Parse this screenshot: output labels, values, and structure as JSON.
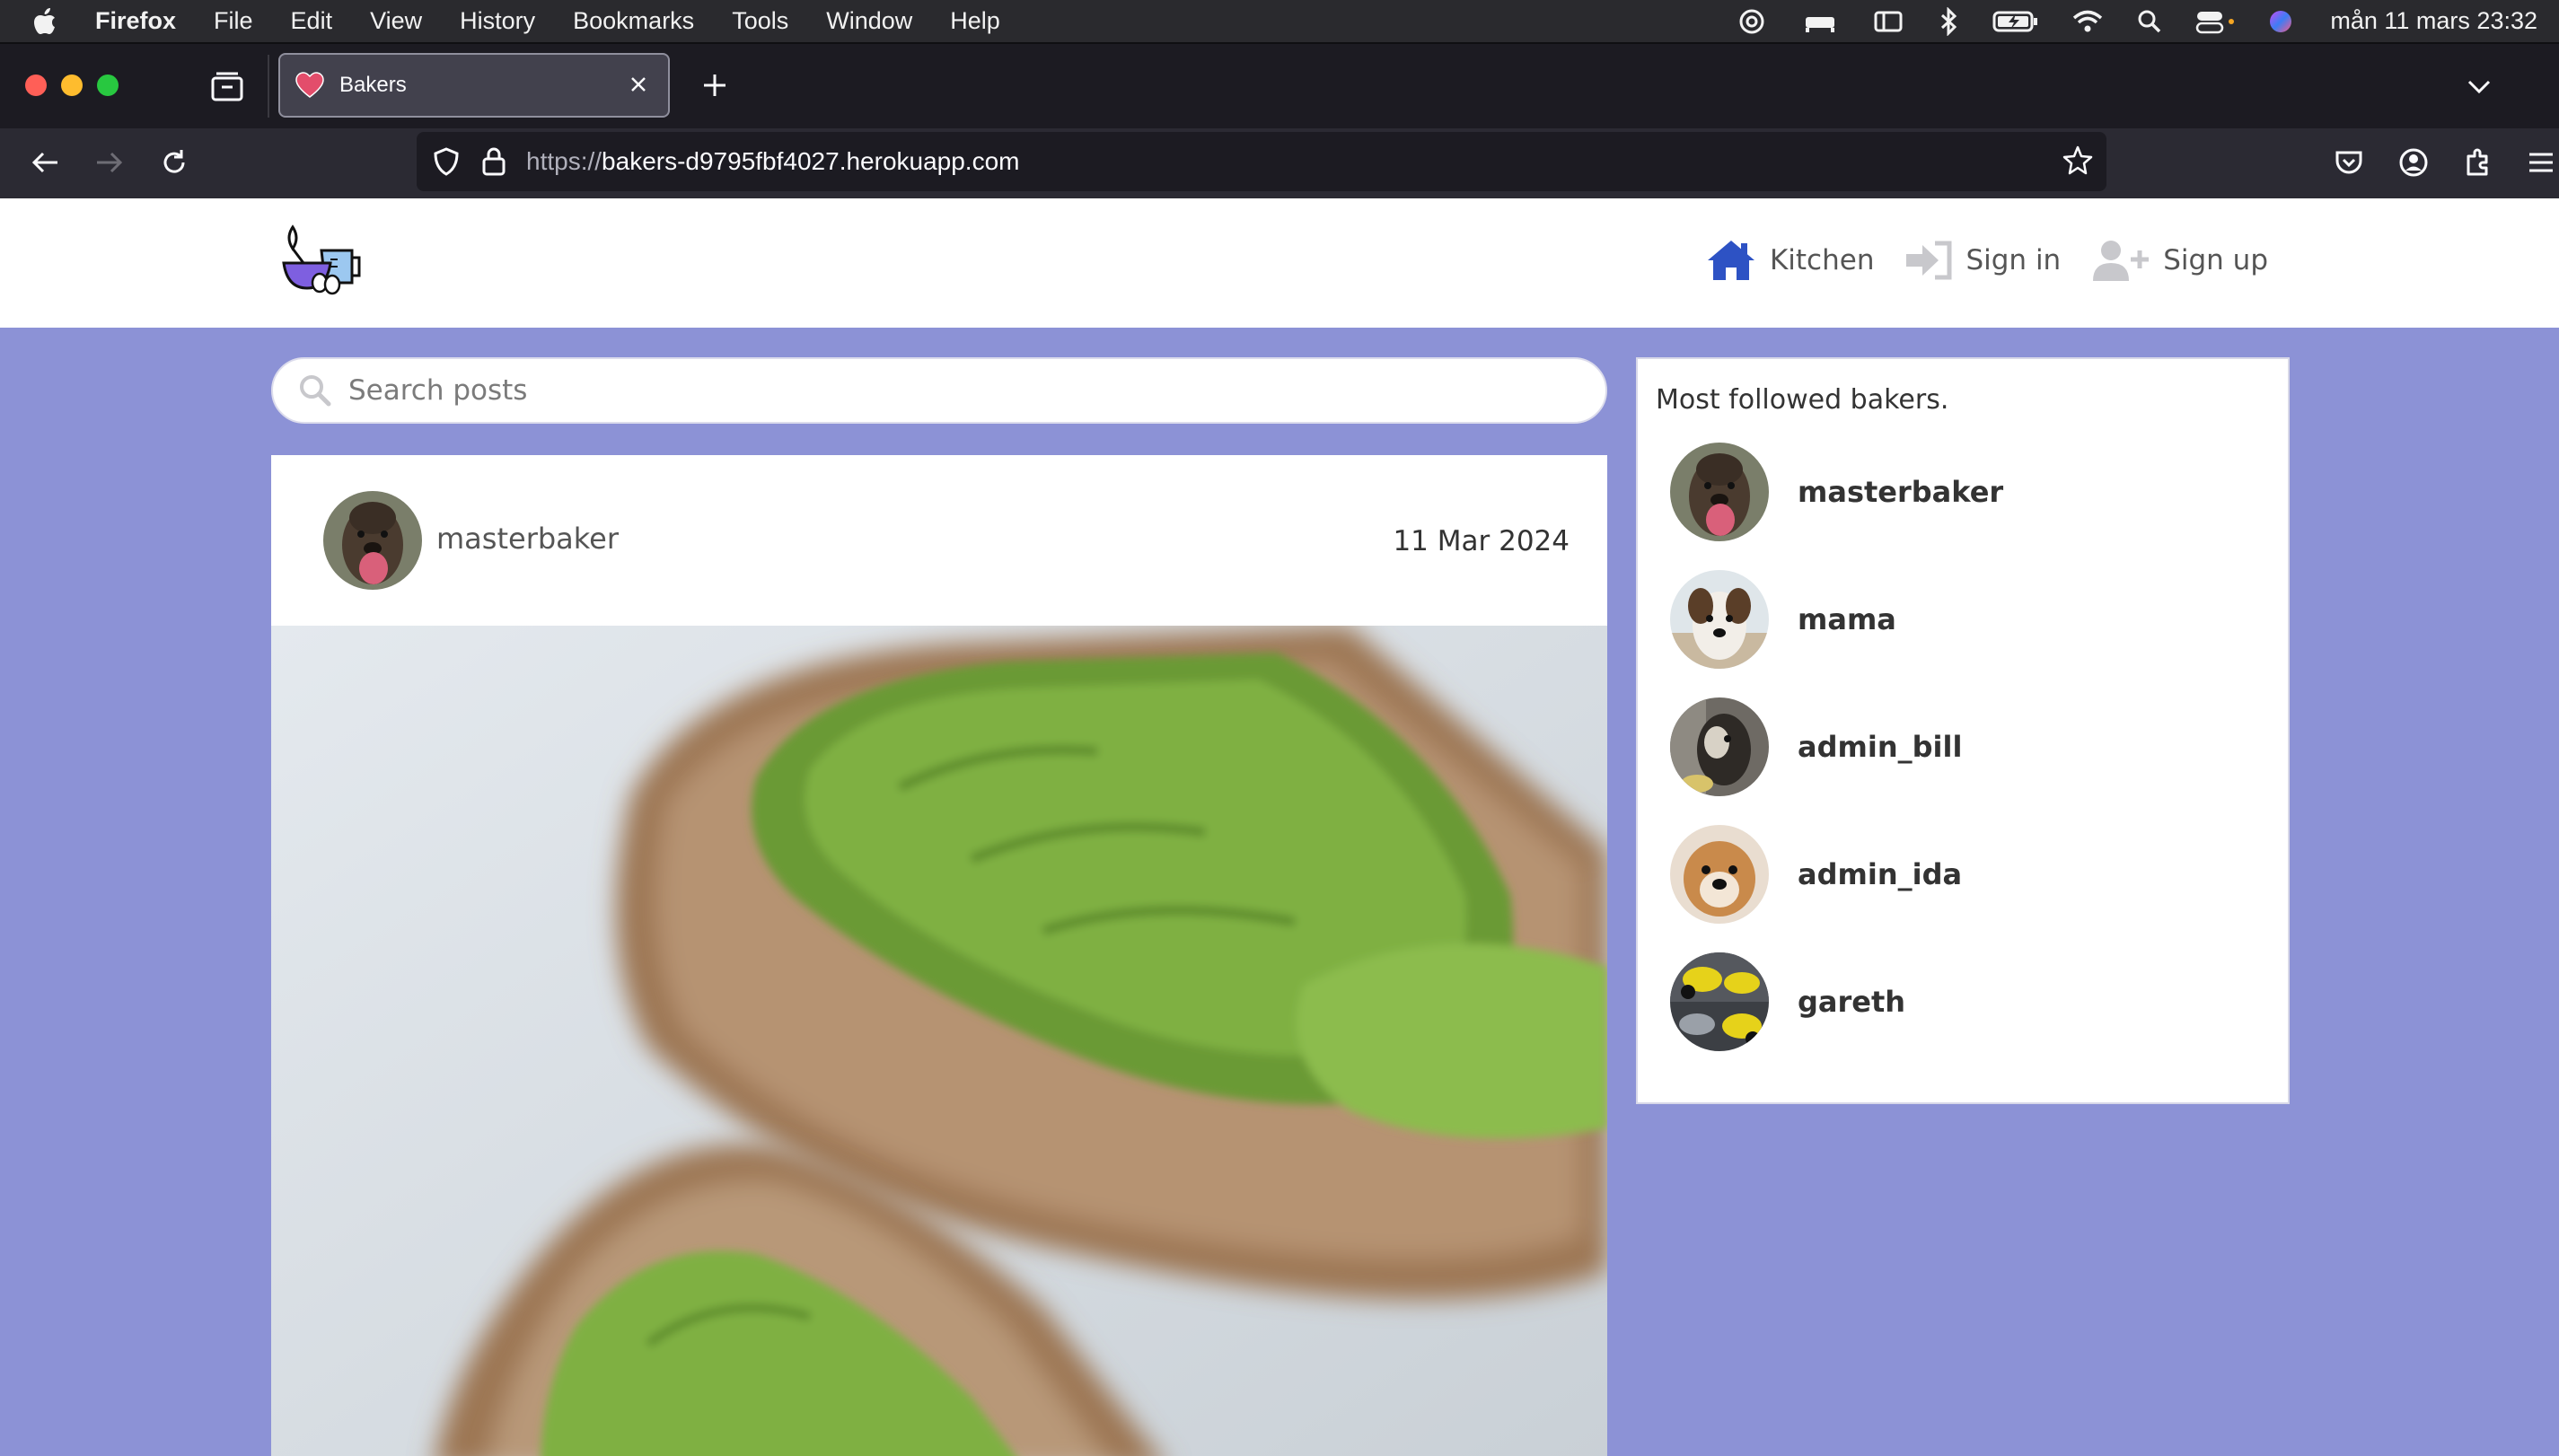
{
  "menubar": {
    "app_name": "Firefox",
    "items": [
      "File",
      "Edit",
      "View",
      "History",
      "Bookmarks",
      "Tools",
      "Window",
      "Help"
    ],
    "clock": "mån 11 mars 23:32"
  },
  "browser": {
    "tab_title": "Bakers",
    "url_scheme": "https://",
    "url_host": "bakers-d9795fbf4027.herokuapp.com"
  },
  "site": {
    "nav": {
      "kitchen": "Kitchen",
      "sign_in": "Sign in",
      "sign_up": "Sign up"
    },
    "search_placeholder": "Search posts",
    "post": {
      "author": "masterbaker",
      "date": "11 Mar 2024"
    },
    "sidebar": {
      "title": "Most followed bakers.",
      "bakers": [
        {
          "name": "masterbaker"
        },
        {
          "name": "mama"
        },
        {
          "name": "admin_bill"
        },
        {
          "name": "admin_ida"
        },
        {
          "name": "gareth"
        }
      ]
    }
  },
  "colors": {
    "page_background": "#8c92d6",
    "brand_blue": "#2d52c4"
  }
}
